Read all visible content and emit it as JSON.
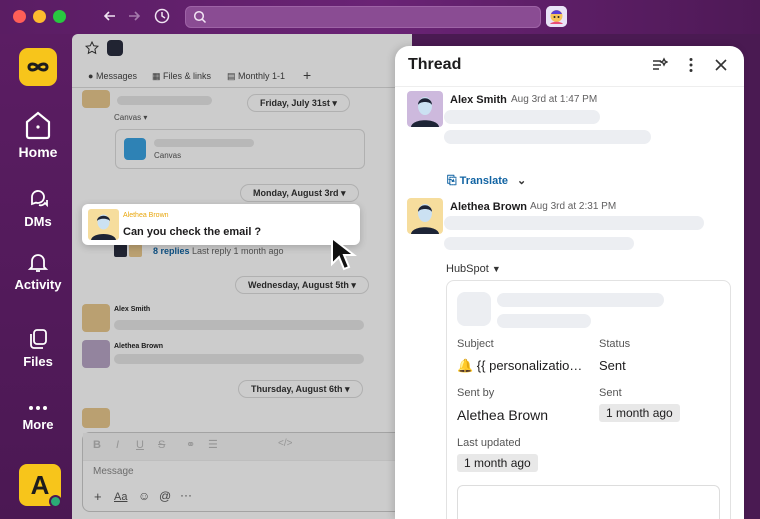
{
  "app": {
    "colors": {
      "aubergine": "#4a1a52",
      "accent_yellow": "#f7c51b",
      "link_blue": "#1264a3",
      "presence_green": "#2bac76"
    }
  },
  "rail": {
    "items": [
      {
        "label": "Home",
        "icon": "home-icon"
      },
      {
        "label": "DMs",
        "icon": "dms-icon"
      },
      {
        "label": "Activity",
        "icon": "bell-icon"
      },
      {
        "label": "Files",
        "icon": "files-icon"
      },
      {
        "label": "More",
        "icon": "more-icon"
      }
    ],
    "user_initial": "A"
  },
  "channel": {
    "tabs": [
      "Messages",
      "Files & links",
      "Monthly 1-1"
    ],
    "dates": [
      "Friday, July 31st",
      "Monday, August 3rd",
      "Wednesday, August 5th",
      "Thursday, August 6th"
    ],
    "canvas_label": "Canvas",
    "canvas_item": "Canvas",
    "replies": "8 replies",
    "last_reply": "Last reply 1 month ago",
    "names": [
      "Alex Smith",
      "Alethea Brown"
    ],
    "composer_placeholder": "Message",
    "highlight": {
      "name": "Alethea Brown",
      "text": "Can you check the email ?"
    }
  },
  "thread": {
    "title": "Thread",
    "messages": [
      {
        "name": "Alex Smith",
        "time": "Aug 3rd at 1:47 PM"
      },
      {
        "name": "Alethea Brown",
        "time": "Aug 3rd at 2:31 PM"
      }
    ],
    "translate_label": "Translate",
    "app_name": "HubSpot",
    "card": {
      "subject_label": "Subject",
      "subject_value": "🔔 {{ personalizatio…",
      "status_label": "Status",
      "status_value": "Sent",
      "sent_by_label": "Sent by",
      "sent_by_value": "Alethea Brown",
      "sent_label": "Sent",
      "sent_value": "1 month ago",
      "last_updated_label": "Last updated",
      "last_updated_value": "1 month ago"
    }
  }
}
